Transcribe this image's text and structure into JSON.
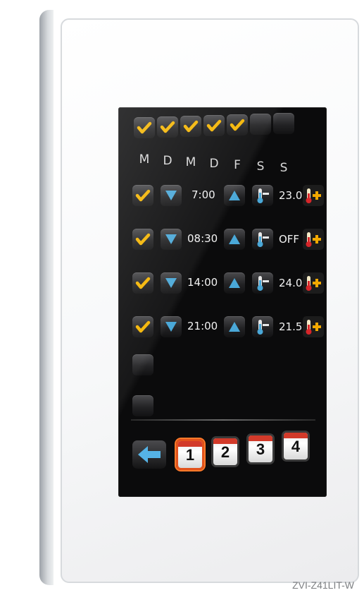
{
  "days": [
    "M",
    "D",
    "M",
    "D",
    "F",
    "S",
    "S"
  ],
  "days_checked": [
    true,
    true,
    true,
    true,
    true,
    false,
    false
  ],
  "schedule": [
    {
      "enabled": true,
      "time": "7:00",
      "temp": "23.0"
    },
    {
      "enabled": true,
      "time": "08:30",
      "temp": "OFF"
    },
    {
      "enabled": true,
      "time": "14:00",
      "temp": "24.0"
    },
    {
      "enabled": true,
      "time": "21:00",
      "temp": "21.5"
    }
  ],
  "empty_slots": 2,
  "programs": [
    "1",
    "2",
    "3",
    "4"
  ],
  "active_program": "1",
  "product_code": "ZVI-Z41LIT-W",
  "icons": {
    "check": "checkmark-icon",
    "down": "arrow-down-icon",
    "up": "arrow-up-icon",
    "thermo": "thermometer-minus-icon",
    "thermo_plus": "thermometer-plus-icon",
    "back": "arrow-left-icon",
    "calendar": "calendar-icon"
  },
  "colors": {
    "check": "#f4b400",
    "arrow": "#4aa8d8",
    "thermo_plus": "#f2a900",
    "active_program": "#e2521c"
  }
}
